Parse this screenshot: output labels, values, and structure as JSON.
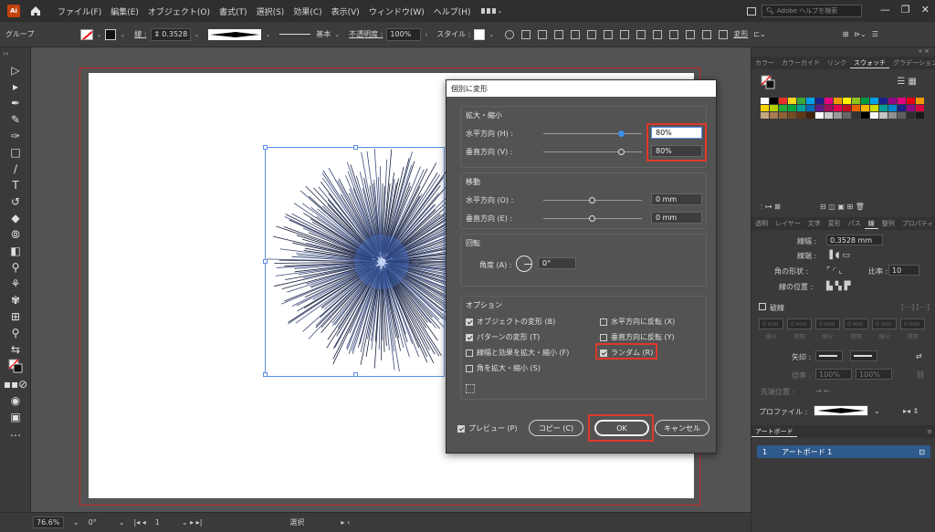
{
  "app": {
    "logo": "Ai",
    "workspace_label": "▦"
  },
  "menu": {
    "items": [
      "ファイル(F)",
      "編集(E)",
      "オブジェクト(O)",
      "書式(T)",
      "選択(S)",
      "効果(C)",
      "表示(V)",
      "ウィンドウ(W)",
      "ヘルプ(H)"
    ]
  },
  "search": {
    "placeholder": "Adobe ヘルプを検索"
  },
  "control_bar": {
    "selection_label": "グループ",
    "stroke_label": "線 :",
    "stroke_value": "0.3528",
    "stroke_style": "基本",
    "opacity_label": "不透明度 :",
    "opacity_value": "100%",
    "style_label": "スタイル :",
    "transform_label": "変形"
  },
  "status_bar": {
    "zoom": "76.6%",
    "rotation": "0°",
    "artboard_num": "1",
    "mode": "選択"
  },
  "dialog": {
    "title": "個別に変形",
    "scale_section": "拡大・縮小",
    "horizontal_label": "水平方向 (H) :",
    "horizontal_value": "80%",
    "vertical_label": "垂直方向 (V) :",
    "vertical_value": "80%",
    "move_section": "移動",
    "move_h_label": "水平方向 (O) :",
    "move_h_value": "0 mm",
    "move_v_label": "垂直方向 (E) :",
    "move_v_value": "0 mm",
    "rotate_section": "回転",
    "angle_label": "角度 (A) :",
    "angle_value": "0°",
    "options_section": "オプション",
    "opt_transform_objects": "オブジェクトの変形 (B)",
    "opt_transform_patterns": "パターンの変形 (T)",
    "opt_scale_strokes": "線幅と効果を拡大・縮小 (F)",
    "opt_scale_corners": "角を拡大・縮小 (S)",
    "opt_reflect_x": "水平方向に反転 (X)",
    "opt_reflect_y": "垂直方向に反転 (Y)",
    "opt_random": "ランダム (R)",
    "preview_label": "プレビュー (P)",
    "copy_button": "コピー (C)",
    "ok_button": "OK",
    "cancel_button": "キャンセル",
    "horizontal_fraction": 0.8,
    "vertical_fraction": 0.8,
    "move_h_fraction": 0.5,
    "move_v_fraction": 0.5
  },
  "swatches_panel": {
    "tabs": [
      "カラー",
      "カラーガイド",
      "リンク",
      "スウォッチ",
      "グラデーション"
    ],
    "active_tab": "スウォッチ",
    "colors": [
      "#ffffff",
      "#000000",
      "#e63027",
      "#f9d71c",
      "#3aa935",
      "#00a0e9",
      "#1d2088",
      "#e4007f",
      "#f39800",
      "#fff100",
      "#8fc31f",
      "#009944",
      "#00a0e9",
      "#1d2088",
      "#920783",
      "#e4007f",
      "#e60012",
      "#f39800",
      "#fdd000",
      "#b5d100",
      "#22ac38",
      "#00a73c",
      "#00a29a",
      "#0068b7",
      "#601986",
      "#a40b5d",
      "#e5004f",
      "#c30d23",
      "#eb6100",
      "#f8b500",
      "#cfdb00",
      "#009e96",
      "#0086d1",
      "#1d2088",
      "#920783",
      "#d7003a",
      "#c7a77f",
      "#a67c52",
      "#8c6239",
      "#754c24",
      "#603813",
      "#42210b",
      "#ffffff",
      "#cccccc",
      "#999999",
      "#666666",
      "#333333",
      "#000000",
      "#f5f5f5",
      "#c4c4c4",
      "#8f8f8f",
      "#5e5e5e",
      "#2e2e2e",
      "#1a1a1a"
    ]
  },
  "stroke_panel": {
    "tabs": [
      "透明",
      "レイヤー",
      "文字",
      "変形",
      "パス",
      "線",
      "整列",
      "プロパティ"
    ],
    "active_tab": "線",
    "weight_label": "線幅 :",
    "weight_value": "0.3528 mm",
    "cap_label": "線端 :",
    "corner_label": "角の形状 :",
    "limit_label": "比率 :",
    "limit_value": "10",
    "align_label": "線の位置 :",
    "dashed_label": "破線",
    "dash_fields": [
      "0 mm",
      "0 mm",
      "0 mm",
      "0 mm",
      "0 mm",
      "0 mm"
    ],
    "dash_labels": [
      "線分",
      "間隔",
      "線分",
      "間隔",
      "線分",
      "間隔"
    ],
    "arrow_label": "矢印 :",
    "scale_label": "倍率 :",
    "scale_value_1": "100%",
    "scale_value_2": "100%",
    "arrow_pos_label": "先端位置 :",
    "profile_label": "プロファイル :"
  },
  "artboards_panel": {
    "tab": "アートボード",
    "items": [
      {
        "num": "1",
        "name": "アートボード 1"
      }
    ]
  }
}
